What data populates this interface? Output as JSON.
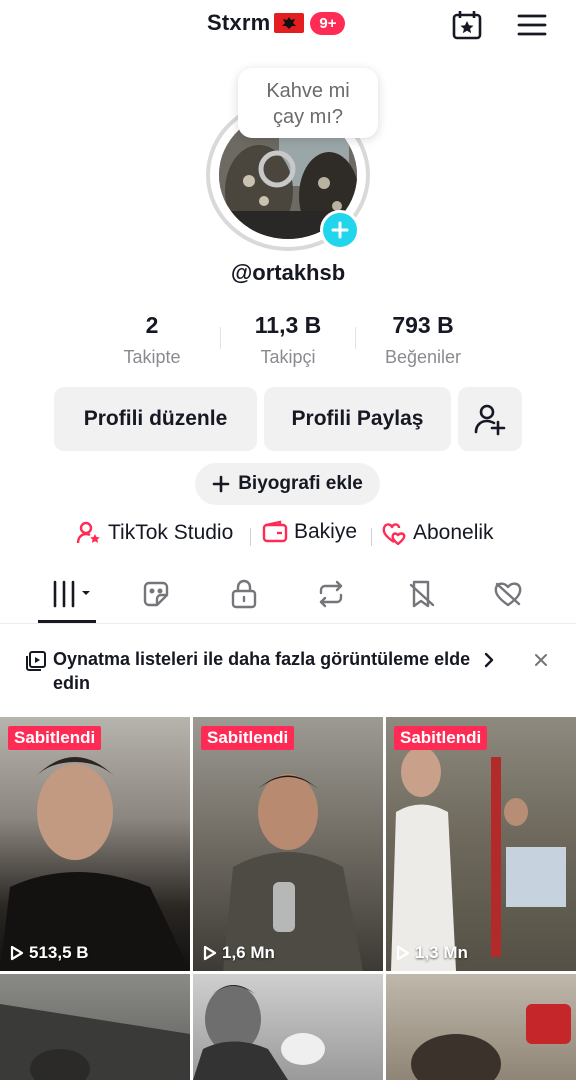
{
  "header": {
    "username": "Stxrm",
    "notification_count": "9+"
  },
  "profile": {
    "bubble_line1": "Kahve mi",
    "bubble_line2": "çay mı?",
    "handle": "@ortakhsb"
  },
  "stats": [
    {
      "value": "2",
      "label": "Takipte"
    },
    {
      "value": "11,3 B",
      "label": "Takipçi"
    },
    {
      "value": "793 B",
      "label": "Beğeniler"
    }
  ],
  "buttons": {
    "edit_profile": "Profili düzenle",
    "share_profile": "Profili Paylaş",
    "add_bio": "Biyografi ekle"
  },
  "links": [
    {
      "label": "TikTok Studio",
      "icon": "person-star-icon"
    },
    {
      "label": "Bakiye",
      "icon": "wallet-icon"
    },
    {
      "label": "Abonelik",
      "icon": "hearts-icon"
    }
  ],
  "tabs": [
    "videos-grid-icon",
    "sticker-icon",
    "lock-icon",
    "repost-icon",
    "favorites-icon",
    "liked-icon"
  ],
  "banner": {
    "text": "Oynatma listeleri ile daha fazla görüntüleme elde edin"
  },
  "videos": [
    {
      "pinned": "Sabitlendi",
      "views": "513,5 B"
    },
    {
      "pinned": "Sabitlendi",
      "views": "1,6 Mn"
    },
    {
      "pinned": "Sabitlendi",
      "views": "1,3 Mn"
    }
  ],
  "colors": {
    "accent": "#fe2c55",
    "plus": "#20d5ec",
    "button_bg": "#f1f1f2",
    "text": "#161823",
    "muted": "#8a8b91"
  }
}
